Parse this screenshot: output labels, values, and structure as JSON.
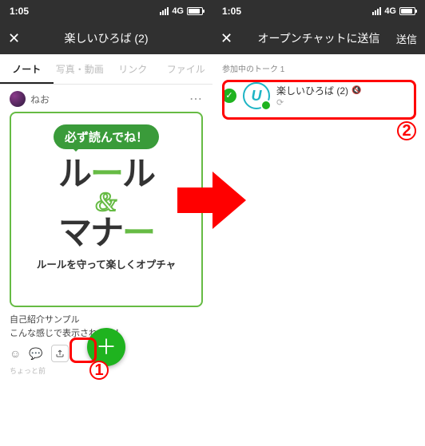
{
  "statusbar": {
    "time": "1:05",
    "network": "4G"
  },
  "left": {
    "title": "楽しいひろば (2)",
    "tabs": {
      "note": "ノート",
      "photo": "写真・動画",
      "link": "リンク",
      "file": "ファイル"
    },
    "post": {
      "user": "ねお",
      "bubble": "必ず読んでね！",
      "line1a": "ル",
      "line1b": "ー",
      "line1c": "ル",
      "amp": "&",
      "line2a": "マナ",
      "line2b": "ー",
      "subtitle": "ルールを守って楽しくオプチャ",
      "text1": "自己紹介サンプル",
      "text2": "こんな感じで表示されるよ！",
      "timestamp": "ちょっと前"
    },
    "fab": "＋"
  },
  "right": {
    "title": "オープンチャットに送信",
    "send": "送信",
    "section": "参加中のトーク 1",
    "chat": {
      "name": "楽しいひろば (2)",
      "sub": "⟳"
    }
  },
  "callouts": {
    "one": "1",
    "two": "2"
  }
}
